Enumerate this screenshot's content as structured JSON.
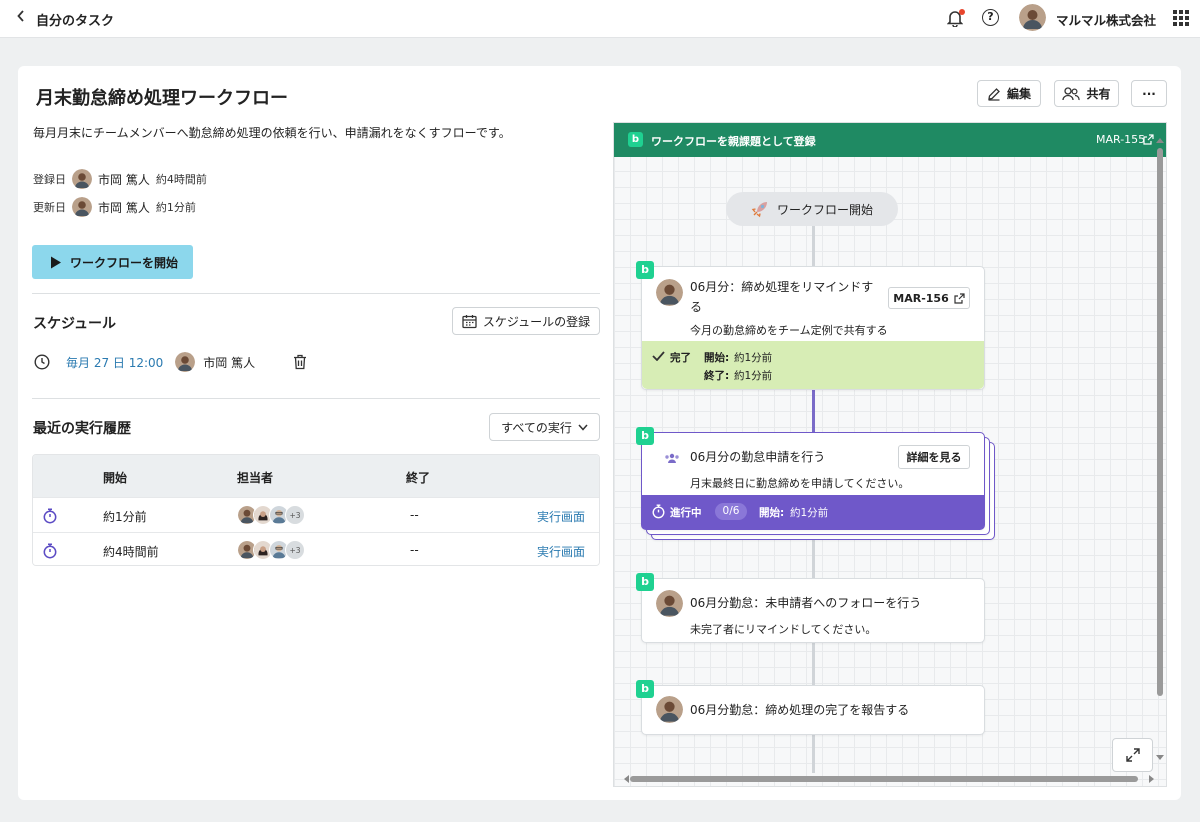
{
  "topbar": {
    "back_icon": "chevron-left-icon",
    "title": "自分のタスク",
    "company": "マルマル株式会社"
  },
  "page": {
    "title": "月末勤怠締め処理ワークフロー",
    "edit_label": "編集",
    "share_label": "共有",
    "more_label": "···",
    "description": "毎月月末にチームメンバーへ勤怠締め処理の依頼を行い、申請漏れをなくすフローです。",
    "registered_label": "登録日",
    "registered_user": "市岡 篤人",
    "registered_time": "約4時間前",
    "updated_label": "更新日",
    "updated_user": "市岡 篤人",
    "updated_time": "約1分前",
    "start_button": "ワークフローを開始"
  },
  "schedule": {
    "title": "スケジュール",
    "register_button": "スケジュールの登録",
    "when": "毎月 27 日 12:00",
    "user": "市岡 篤人"
  },
  "history": {
    "title": "最近の実行履歴",
    "filter": "すべての実行",
    "columns": {
      "start": "開始",
      "assignee": "担当者",
      "end": "終了"
    },
    "rows": [
      {
        "start": "約1分前",
        "more": "+3",
        "end": "--",
        "link": "実行画面"
      },
      {
        "start": "約4時間前",
        "more": "+3",
        "end": "--",
        "link": "実行画面"
      }
    ]
  },
  "panel": {
    "header": "ワークフローを親課題として登録",
    "ticket": "MAR-155",
    "start_pill": "ワークフロー開始",
    "nodes": [
      {
        "title": "06月分：締め処理をリマインドする",
        "ticket": "MAR-156",
        "sub": "今月の勤怠締めをチーム定例で共有する",
        "status": "完了",
        "start_label": "開始:",
        "start_time": "約1分前",
        "end_label": "終了:",
        "end_time": "約1分前"
      },
      {
        "title": "06月分の勤怠申請を行う",
        "detail_button": "詳細を見る",
        "sub": "月末最終日に勤怠締めを申請してください。",
        "status": "進行中",
        "count": "0/6",
        "start_label": "開始:",
        "start_time": "約1分前"
      },
      {
        "title": "06月分勤怠：未申請者へのフォローを行う",
        "sub": "未完了者にリマインドしてください。"
      },
      {
        "title": "06月分勤怠：締め処理の完了を報告する"
      }
    ]
  },
  "colors": {
    "accent": "#1f8a63",
    "progress": "#6f58c9",
    "done": "#d7edb5",
    "start_button": "#8cd7ec",
    "link": "#2a7ab0"
  }
}
